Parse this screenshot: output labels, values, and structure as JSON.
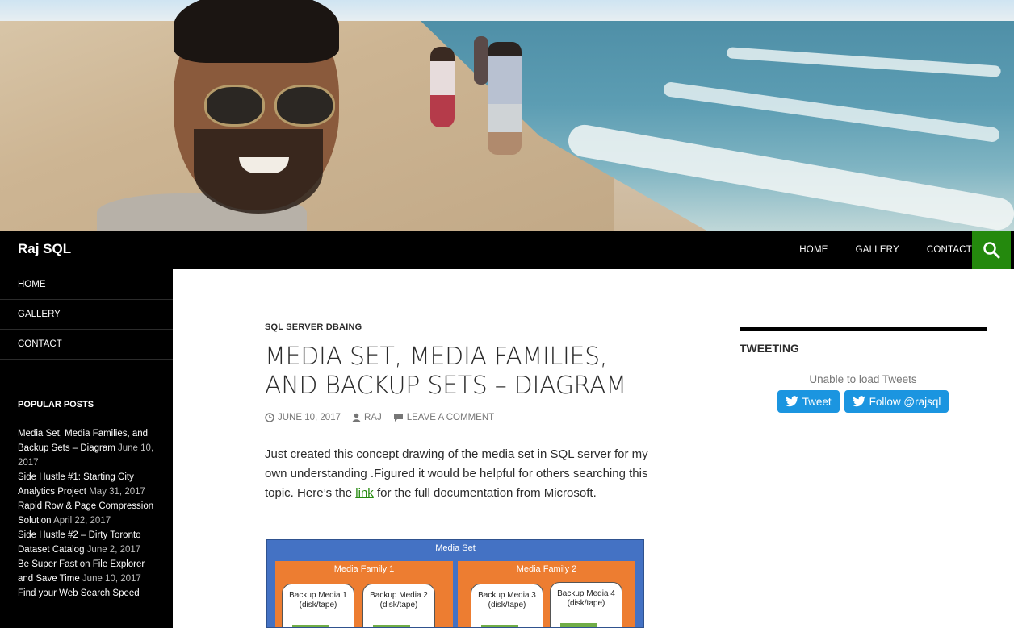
{
  "site": {
    "title": "Raj SQL"
  },
  "top_nav": {
    "items": [
      "HOME",
      "GALLERY",
      "CONTACT"
    ]
  },
  "side_menu": {
    "items": [
      "HOME",
      "GALLERY",
      "CONTACT"
    ]
  },
  "popular_posts": {
    "heading": "POPULAR POSTS",
    "posts": [
      {
        "title": "Media Set, Media Families, and Backup Sets – Diagram",
        "date": "June 10, 2017"
      },
      {
        "title": "Side Hustle #1: Starting City Analytics Project",
        "date": "May 31, 2017"
      },
      {
        "title": "Rapid Row & Page Compression Solution",
        "date": "April 22, 2017"
      },
      {
        "title": "Side Hustle #2 – Dirty Toronto Dataset Catalog",
        "date": "June 2, 2017"
      },
      {
        "title": "Be Super Fast on File Explorer and Save Time",
        "date": "June 10, 2017"
      },
      {
        "title": "Find your Web Search Speed",
        "date": ""
      }
    ]
  },
  "article": {
    "category": "SQL SERVER DBAING",
    "title": "MEDIA SET, MEDIA FAMILIES, AND BACKUP SETS – DIAGRAM",
    "date": "JUNE 10, 2017",
    "author": "RAJ",
    "comment": "LEAVE A COMMENT",
    "body_before_link": "Just created this concept drawing of the media set in SQL server for my own understanding .Figured it would be helpful for others searching this topic.  Here’s the ",
    "link_text": "link",
    "body_after_link": " for the full documentation from Microsoft."
  },
  "diagram": {
    "title": "Media Set",
    "families": [
      {
        "title": "Media Family 1",
        "media": [
          "Backup Media 1",
          "Backup Media 2"
        ]
      },
      {
        "title": "Media Family 2",
        "media": [
          "Backup Media 3",
          "Backup Media 4"
        ]
      }
    ],
    "media_sub": "(disk/tape)",
    "colors": {
      "set": "#4472c4",
      "family": "#ed7d31",
      "tag": "#70ad47"
    }
  },
  "widget": {
    "heading": "TWEETING",
    "message": "Unable to load Tweets",
    "tweet_button": "Tweet",
    "follow_button": "Follow @rajsql"
  },
  "colors": {
    "accent": "#24890d",
    "bar": "#000000",
    "twitter": "#1b95e0"
  }
}
